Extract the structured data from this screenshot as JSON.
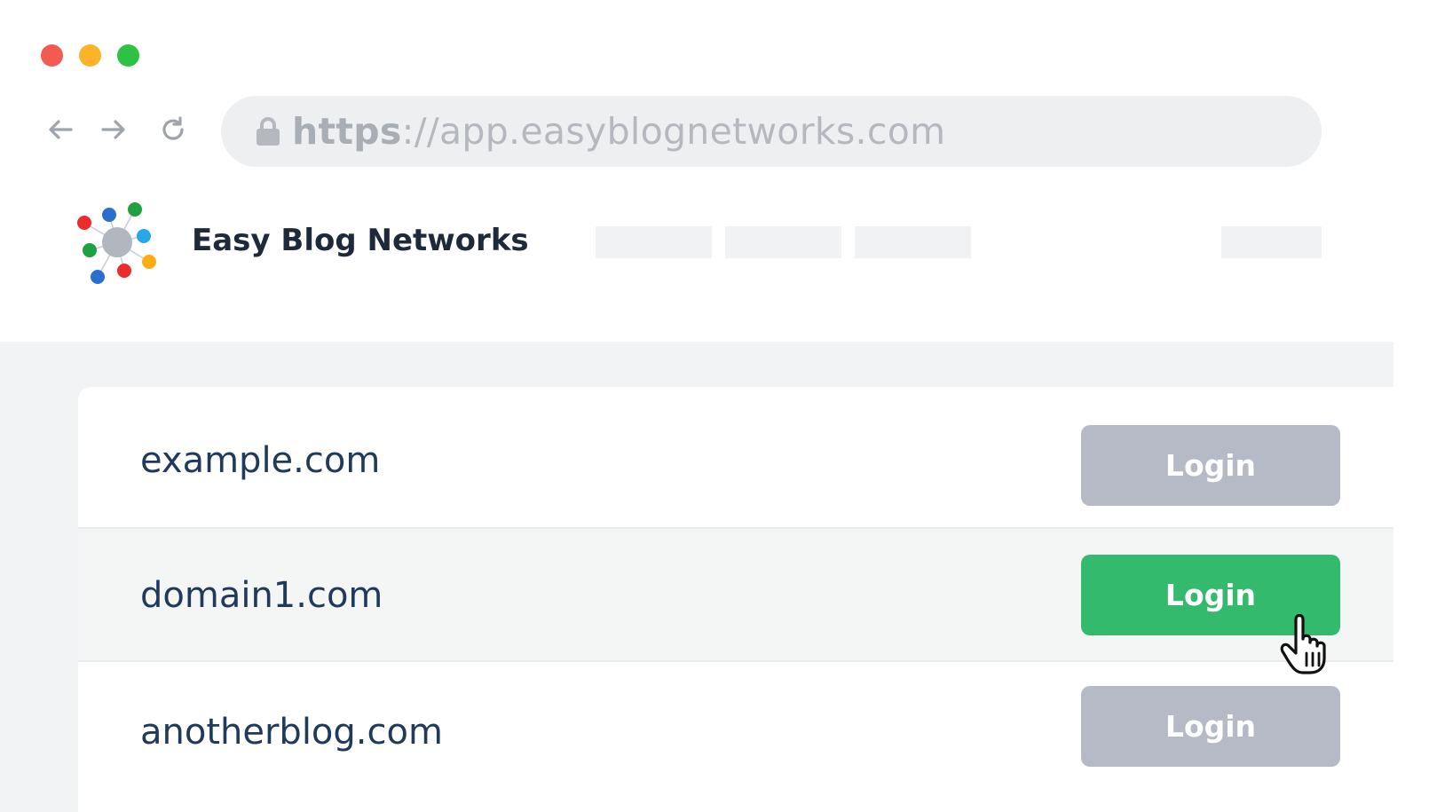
{
  "browser": {
    "url_scheme": "https",
    "url_rest": "://app.easyblognetworks.com",
    "traffic_lights": [
      "#f25a52",
      "#fbb32a",
      "#2dc243"
    ]
  },
  "app": {
    "brand": "Easy Blog Networks"
  },
  "sites": [
    {
      "domain": "example.com",
      "button": "Login",
      "state": "default"
    },
    {
      "domain": "domain1.com",
      "button": "Login",
      "state": "hover"
    },
    {
      "domain": "anotherblog.com",
      "button": "Login",
      "state": "default"
    }
  ],
  "colors": {
    "button_default": "#b5bac6",
    "button_hover": "#33ba6c",
    "domain_text": "#1f3a5a"
  },
  "icons": [
    "back-arrow-icon",
    "forward-arrow-icon",
    "reload-icon",
    "lock-icon",
    "hand-pointer-icon"
  ]
}
